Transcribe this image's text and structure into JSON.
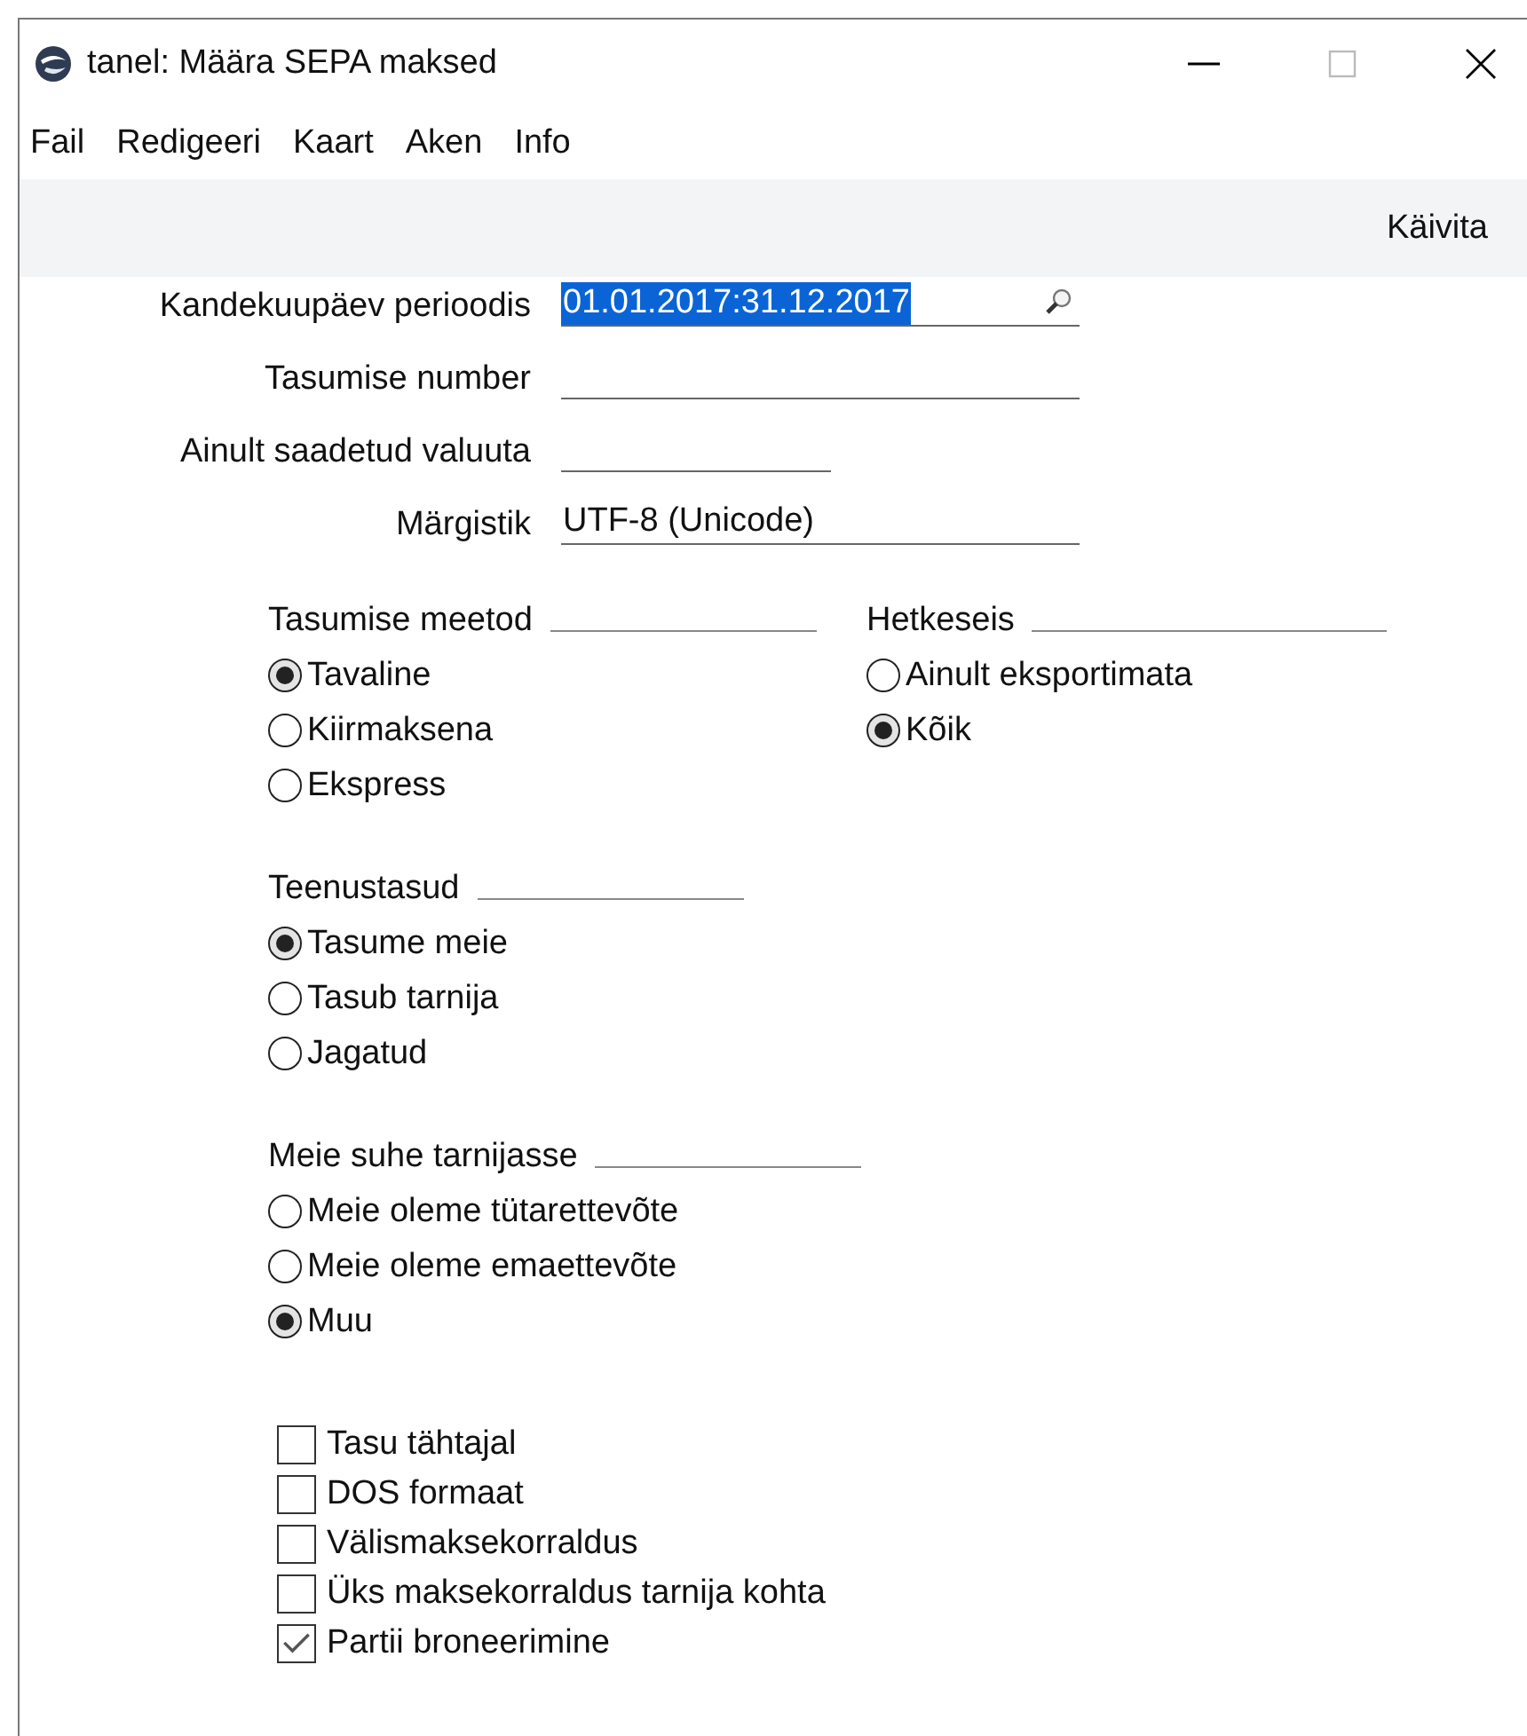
{
  "window": {
    "title": "tanel: Määra SEPA maksed"
  },
  "menu": [
    "Fail",
    "Redigeeri",
    "Kaart",
    "Aken",
    "Info"
  ],
  "toolbar": {
    "run_button": "Käivita"
  },
  "fields": [
    {
      "label": "Kandekuupäev perioodis",
      "value": "01.01.2017:31.12.2017",
      "highlighted": true,
      "kind": "lookup"
    },
    {
      "label": "Tasumise number",
      "kind": "text"
    },
    {
      "label": "Ainult saadetud valuuta",
      "kind": "short"
    },
    {
      "label": "Märgistik",
      "value": "UTF-8 (Unicode)",
      "kind": "text"
    }
  ],
  "option_group_rows": [
    [
      {
        "title": "Tasumise meetod",
        "options": [
          {
            "label": "Tavaline",
            "selected": true
          },
          {
            "label": "Kiirmaksena",
            "selected": false
          },
          {
            "label": "Ekspress",
            "selected": false
          }
        ]
      },
      {
        "title": "Hetkeseis",
        "options": [
          {
            "label": "Ainult eksportimata",
            "selected": false
          },
          {
            "label": "Kõik",
            "selected": true
          }
        ]
      }
    ],
    [
      {
        "title": "Teenustasud",
        "options": [
          {
            "label": "Tasume meie",
            "selected": true
          },
          {
            "label": "Tasub tarnija",
            "selected": false
          },
          {
            "label": "Jagatud",
            "selected": false
          }
        ]
      }
    ],
    [
      {
        "title": "Meie suhe tarnijasse",
        "options": [
          {
            "label": "Meie oleme tütarettevõte",
            "selected": false
          },
          {
            "label": "Meie oleme emaettevõte",
            "selected": false
          },
          {
            "label": "Muu",
            "selected": true
          }
        ]
      }
    ]
  ],
  "checkboxes": [
    {
      "label": "Tasu tähtajal",
      "checked": false
    },
    {
      "label": "DOS formaat",
      "checked": false
    },
    {
      "label": "Välismaksekorraldus",
      "checked": false
    },
    {
      "label": "Üks maksekorraldus tarnija kohta",
      "checked": false
    },
    {
      "label": "Partii broneerimine",
      "checked": true
    }
  ]
}
